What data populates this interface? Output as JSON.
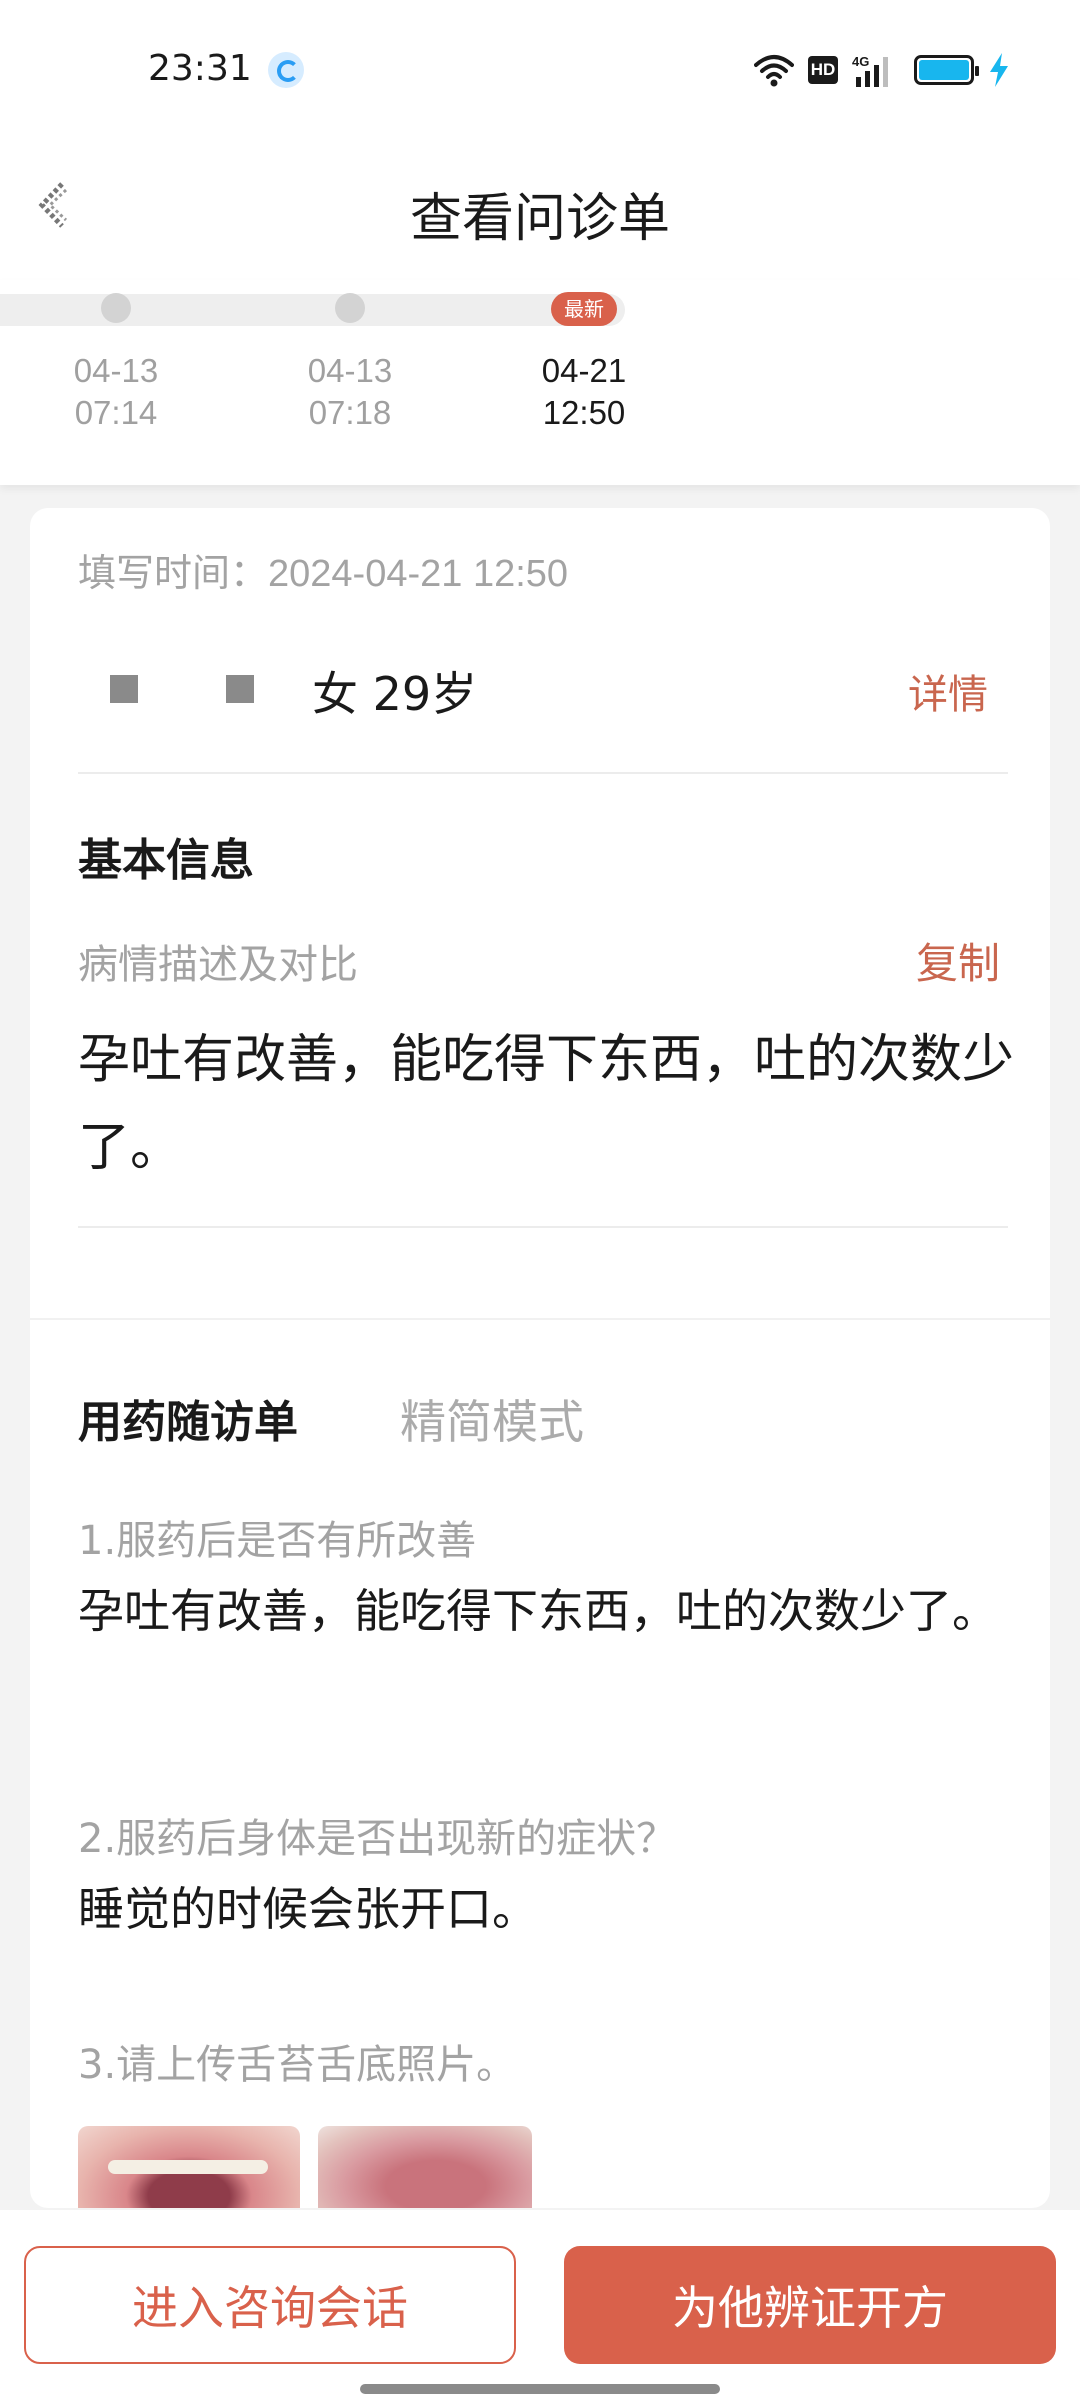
{
  "status_bar": {
    "time": "23:31",
    "hd_label": "HD",
    "network_label": "4G",
    "icons": [
      "app-notification-icon",
      "wifi-icon",
      "hd-icon",
      "signal-icon",
      "battery-icon",
      "charging-bolt-icon"
    ],
    "battery_level": 1.0,
    "battery_color": "#18b6ee"
  },
  "header": {
    "title": "查看问诊单",
    "back_icon": "back-arrow-icon"
  },
  "timeline": {
    "latest_badge": "最新",
    "entries": [
      {
        "date": "04-13",
        "time": "07:14",
        "active": false
      },
      {
        "date": "04-13",
        "time": "07:18",
        "active": false
      },
      {
        "date": "04-21",
        "time": "12:50",
        "active": true
      }
    ]
  },
  "form": {
    "fill_time_label": "填写时间：",
    "fill_time_value": "2024-04-21 12:50",
    "patient_info": "女 29岁",
    "detail_link": "详情"
  },
  "basic_info": {
    "title": "基本信息",
    "description_label": "病情描述及对比",
    "copy_link": "复制",
    "description": "孕吐有改善，能吃得下东西，吐的次数少了。"
  },
  "followup": {
    "title": "用药随访单",
    "mode_tab": "精简模式",
    "questions": [
      {
        "question": "1.服药后是否有所改善",
        "answer": "孕吐有改善，能吃得下东西，吐的次数少了。"
      },
      {
        "question": "2.服药后身体是否出现新的症状？",
        "answer": "睡觉的时候会张开口。"
      },
      {
        "question": "3.请上传舌苔舌底照片。",
        "answer": ""
      }
    ]
  },
  "actions": {
    "consult_button": "进入咨询会话",
    "prescribe_button": "为他辨证开方"
  },
  "colors": {
    "accent": "#d9614b",
    "link": "#c9664e",
    "muted_text": "#a3a3a3",
    "background": "#f3f3f3"
  }
}
